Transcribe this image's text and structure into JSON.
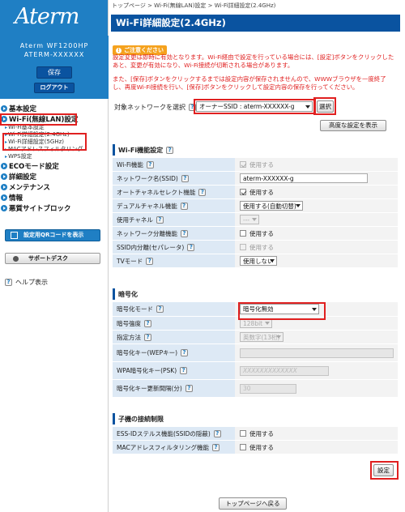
{
  "brand": {
    "logo": "Aterm",
    "model_line1": "Aterm WF1200HP",
    "model_line2": "ATERM-XXXXXX"
  },
  "sidebar": {
    "save_label": "保存",
    "logout_label": "ログアウト",
    "items": [
      {
        "label": "基本設定"
      },
      {
        "label": "Wi-Fi(無線LAN)設定"
      },
      {
        "label": "Wi-Fi基本設定"
      },
      {
        "label": "Wi-Fi詳細設定(2.4GHz)"
      },
      {
        "label": "Wi-Fi詳細設定(5GHz)"
      },
      {
        "label": "MACアドレスフィルタリング"
      },
      {
        "label": "WPS設定"
      },
      {
        "label": "ECOモード設定"
      },
      {
        "label": "詳細設定"
      },
      {
        "label": "メンテナンス"
      },
      {
        "label": "情報"
      },
      {
        "label": "悪質サイトブロック"
      }
    ],
    "qr_label": "設定用QRコードを表示",
    "support_label": "サポートデスク",
    "help_label": "ヘルプ表示"
  },
  "breadcrumb": "トップページ > Wi-Fi(無線LAN)設定 > Wi-Fi詳細設定(2.4GHz)",
  "page_title": "Wi-Fi詳細設定(2.4GHz)",
  "notice": {
    "badge": "ご注意ください",
    "line1": "設定変更は即時に有効となります。Wi-Fi経由で設定を行っている場合には、[設定]ボタンをクリックしたあと、変更が有効になり、Wi-Fi接続が切断される場合があります。",
    "line2": "また、[保存]ボタンをクリックするまでは設定内容が保存されませんので、WWWブラウザを一度終了し、再度Wi-Fi接続を行い、[保存]ボタンをクリックして設定内容の保存を行ってください。"
  },
  "network_select": {
    "label": "対象ネットワークを選択",
    "value": "オーナーSSID : aterm-XXXXXX-g",
    "select_button": "選択"
  },
  "advanced_button": "高度な設定を表示",
  "wifi_section": {
    "title": "Wi-Fi機能設定",
    "rows": [
      {
        "label": "Wi-Fi機能",
        "value": "使用する"
      },
      {
        "label": "ネットワーク名(SSID)",
        "value": "aterm-XXXXXX-g"
      },
      {
        "label": "オートチャネルセレクト機能",
        "value": "使用する"
      },
      {
        "label": "デュアルチャネル機能",
        "value": "使用する(自動切替)"
      },
      {
        "label": "使用チャネル",
        "value": "---"
      },
      {
        "label": "ネットワーク分離機能",
        "value": "使用する"
      },
      {
        "label": "SSID内分離(セパレータ)",
        "value": "使用する"
      },
      {
        "label": "TVモード",
        "value": "使用しない"
      }
    ]
  },
  "enc_section": {
    "title": "暗号化",
    "rows": [
      {
        "label": "暗号化モード",
        "value": "暗号化無効"
      },
      {
        "label": "暗号強度",
        "value": "128bit"
      },
      {
        "label": "指定方法",
        "value": "英数字(13桁)"
      },
      {
        "label": "暗号化キー(WEPキー)",
        "value": ""
      },
      {
        "label": "WPA暗号化キー(PSK)",
        "value": "XXXXXXXXXXXXX"
      },
      {
        "label": "暗号化キー更新間隔(分)",
        "value": "30"
      }
    ]
  },
  "child_section": {
    "title": "子機の接続制限",
    "rows": [
      {
        "label": "ESS-IDステルス機能(SSIDの隠蔽)",
        "value": "使用する"
      },
      {
        "label": "MACアドレスフィルタリング機能",
        "value": "使用する"
      }
    ]
  },
  "apply_button": "設定",
  "back_button": "トップページへ戻る",
  "colors": {
    "brand_blue": "#1f7fc4",
    "title_blue": "#0a53a0",
    "highlight_red": "#e02020",
    "notice_orange": "#f5a21e"
  }
}
